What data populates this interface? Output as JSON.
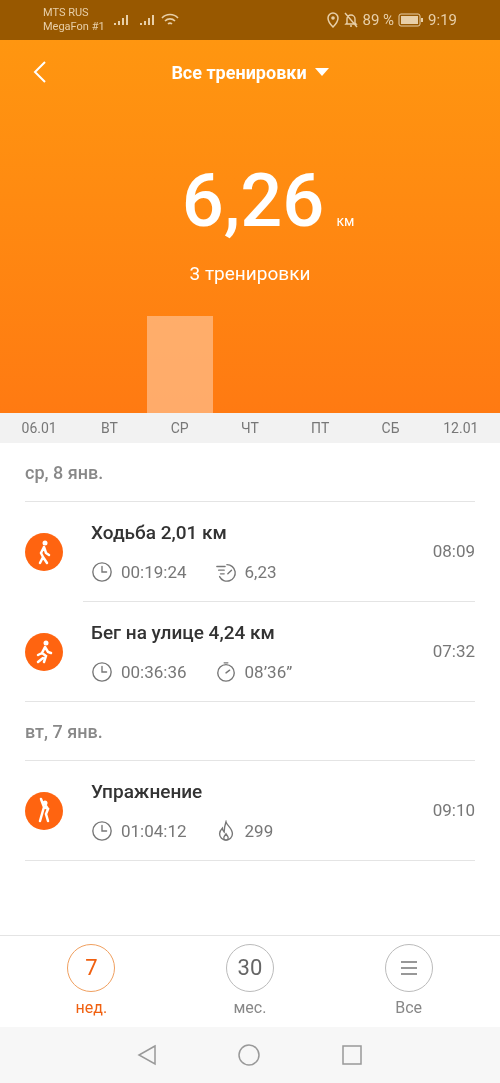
{
  "status_bar": {
    "carrier_1": "MTS RUS",
    "carrier_2": "MegaFon #1",
    "battery": "89 %",
    "time": "9:19"
  },
  "header": {
    "title": "Все тренировки"
  },
  "summary": {
    "value": "6,26",
    "unit": "км",
    "count": "3 тренировки"
  },
  "days": [
    {
      "label": "06.01",
      "bar": false
    },
    {
      "label": "ВТ",
      "bar": false
    },
    {
      "label": "СР",
      "bar": true
    },
    {
      "label": "ЧТ",
      "bar": false
    },
    {
      "label": "ПТ",
      "bar": false
    },
    {
      "label": "СБ",
      "bar": false
    },
    {
      "label": "12.01",
      "bar": false
    }
  ],
  "groups": [
    {
      "date": "ср, 8 янв.",
      "workouts": [
        {
          "kind": "walk",
          "title": "Ходьба 2,01 км",
          "time": "08:09",
          "stats": [
            {
              "kind": "duration",
              "value": "00:19:24"
            },
            {
              "kind": "speed",
              "value": "6,23"
            }
          ]
        },
        {
          "kind": "run",
          "title": "Бег на улице 4,24 км",
          "time": "07:32",
          "stats": [
            {
              "kind": "duration",
              "value": "00:36:36"
            },
            {
              "kind": "pace",
              "value": "08’36”"
            }
          ]
        }
      ]
    },
    {
      "date": "вт, 7 янв.",
      "workouts": [
        {
          "kind": "exercise",
          "title": "Упражнение",
          "time": "09:10",
          "stats": [
            {
              "kind": "duration",
              "value": "01:04:12"
            },
            {
              "kind": "calories",
              "value": "299"
            }
          ]
        }
      ]
    }
  ],
  "periods": [
    {
      "kind": "number",
      "number": "7",
      "label": "нед.",
      "selected": true
    },
    {
      "kind": "number",
      "number": "30",
      "label": "мес.",
      "selected": false
    },
    {
      "kind": "list",
      "label": "Все",
      "selected": false
    }
  ]
}
